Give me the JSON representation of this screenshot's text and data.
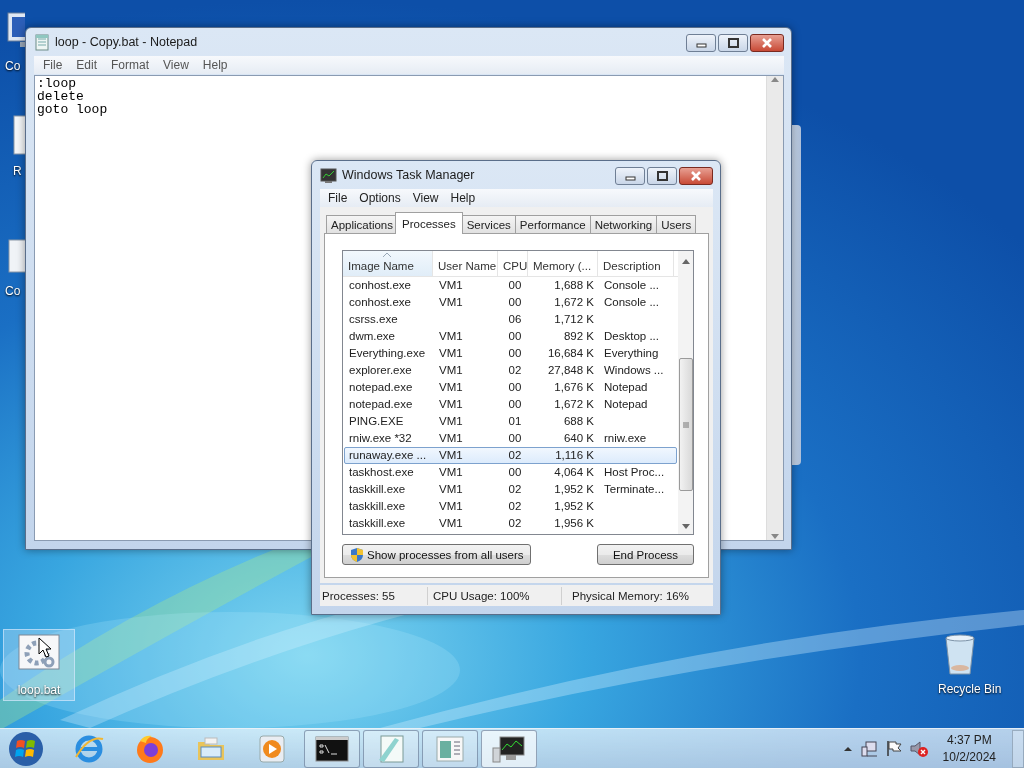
{
  "desktop_icons": [
    {
      "label": "Co",
      "kind": "computer",
      "selected": false
    },
    {
      "label": "R",
      "kind": "document",
      "selected": false
    },
    {
      "label": "Co",
      "kind": "panel",
      "selected": false
    },
    {
      "label": "loop.bat",
      "kind": "batch",
      "selected": true
    },
    {
      "label": "Recycle Bin",
      "kind": "recycle",
      "selected": false
    }
  ],
  "notepad": {
    "title": "loop - Copy.bat - Notepad",
    "menu": [
      "File",
      "Edit",
      "Format",
      "View",
      "Help"
    ],
    "lines": [
      ":loop",
      "delete",
      "goto loop"
    ]
  },
  "task_manager": {
    "title": "Windows Task Manager",
    "menu": [
      "File",
      "Options",
      "View",
      "Help"
    ],
    "tabs": [
      {
        "label": "Applications",
        "selected": false
      },
      {
        "label": "Processes",
        "selected": true
      },
      {
        "label": "Services",
        "selected": false
      },
      {
        "label": "Performance",
        "selected": false
      },
      {
        "label": "Networking",
        "selected": false
      },
      {
        "label": "Users",
        "selected": false
      }
    ],
    "table": {
      "columns": [
        {
          "label": "Image Name",
          "sorted": true
        },
        {
          "label": "User Name",
          "sorted": false
        },
        {
          "label": "CPU",
          "sorted": false
        },
        {
          "label": "Memory (...",
          "sorted": false
        },
        {
          "label": "Description",
          "sorted": false
        }
      ],
      "rows": [
        {
          "image_name": "conhost.exe",
          "user_name": "VM1",
          "cpu": "00",
          "memory": "1,688 K",
          "description": "Console ...",
          "selected": false
        },
        {
          "image_name": "conhost.exe",
          "user_name": "VM1",
          "cpu": "00",
          "memory": "1,672 K",
          "description": "Console ...",
          "selected": false
        },
        {
          "image_name": "csrss.exe",
          "cpu": "06",
          "memory": "1,712 K",
          "selected": false
        },
        {
          "image_name": "dwm.exe",
          "user_name": "VM1",
          "cpu": "00",
          "memory": "892 K",
          "description": "Desktop ...",
          "selected": false
        },
        {
          "image_name": "Everything.exe",
          "user_name": "VM1",
          "cpu": "00",
          "memory": "16,684 K",
          "description": "Everything",
          "selected": false
        },
        {
          "image_name": "explorer.exe",
          "user_name": "VM1",
          "cpu": "02",
          "memory": "27,848 K",
          "description": "Windows ...",
          "selected": false
        },
        {
          "image_name": "notepad.exe",
          "user_name": "VM1",
          "cpu": "00",
          "memory": "1,676 K",
          "description": "Notepad",
          "selected": false
        },
        {
          "image_name": "notepad.exe",
          "user_name": "VM1",
          "cpu": "00",
          "memory": "1,672 K",
          "description": "Notepad",
          "selected": false
        },
        {
          "image_name": "PING.EXE",
          "user_name": "VM1",
          "cpu": "01",
          "memory": "688 K",
          "selected": false
        },
        {
          "image_name": "rniw.exe *32",
          "user_name": "VM1",
          "cpu": "00",
          "memory": "640 K",
          "description": "rniw.exe",
          "selected": false
        },
        {
          "image_name": "runaway.exe ...",
          "user_name": "VM1",
          "cpu": "02",
          "memory": "1,116 K",
          "selected": true
        },
        {
          "image_name": "taskhost.exe",
          "user_name": "VM1",
          "cpu": "00",
          "memory": "4,064 K",
          "description": "Host Proc...",
          "selected": false
        },
        {
          "image_name": "taskkill.exe",
          "user_name": "VM1",
          "cpu": "02",
          "memory": "1,952 K",
          "description": "Terminate...",
          "selected": false
        },
        {
          "image_name": "taskkill.exe",
          "user_name": "VM1",
          "cpu": "02",
          "memory": "1,952 K",
          "selected": false
        },
        {
          "image_name": "taskkill.exe",
          "user_name": "VM1",
          "cpu": "02",
          "memory": "1,956 K",
          "selected": false
        }
      ]
    },
    "buttons": [
      {
        "label": "Show processes from all users",
        "kind": "shield"
      },
      {
        "label": "End Process",
        "kind": "plain"
      }
    ],
    "status_bar": [
      "Processes: 55",
      "CPU Usage: 100%",
      "Physical Memory: 16%"
    ]
  },
  "taskbar": {
    "buttons": [
      {
        "kind": "start",
        "running": false,
        "selected": false
      },
      {
        "kind": "ie",
        "running": false,
        "selected": false
      },
      {
        "kind": "firefox",
        "running": false,
        "selected": false
      },
      {
        "kind": "explorer",
        "running": false,
        "selected": false
      },
      {
        "kind": "media",
        "running": false,
        "selected": false
      },
      {
        "kind": "console",
        "running": true,
        "selected": false
      },
      {
        "kind": "notepad",
        "running": true,
        "selected": false
      },
      {
        "kind": "taskwindow",
        "running": true,
        "selected": false
      },
      {
        "kind": "monitor",
        "running": true,
        "selected": true
      }
    ],
    "clock": {
      "time": "4:37 PM",
      "date": "10/2/2024"
    }
  }
}
